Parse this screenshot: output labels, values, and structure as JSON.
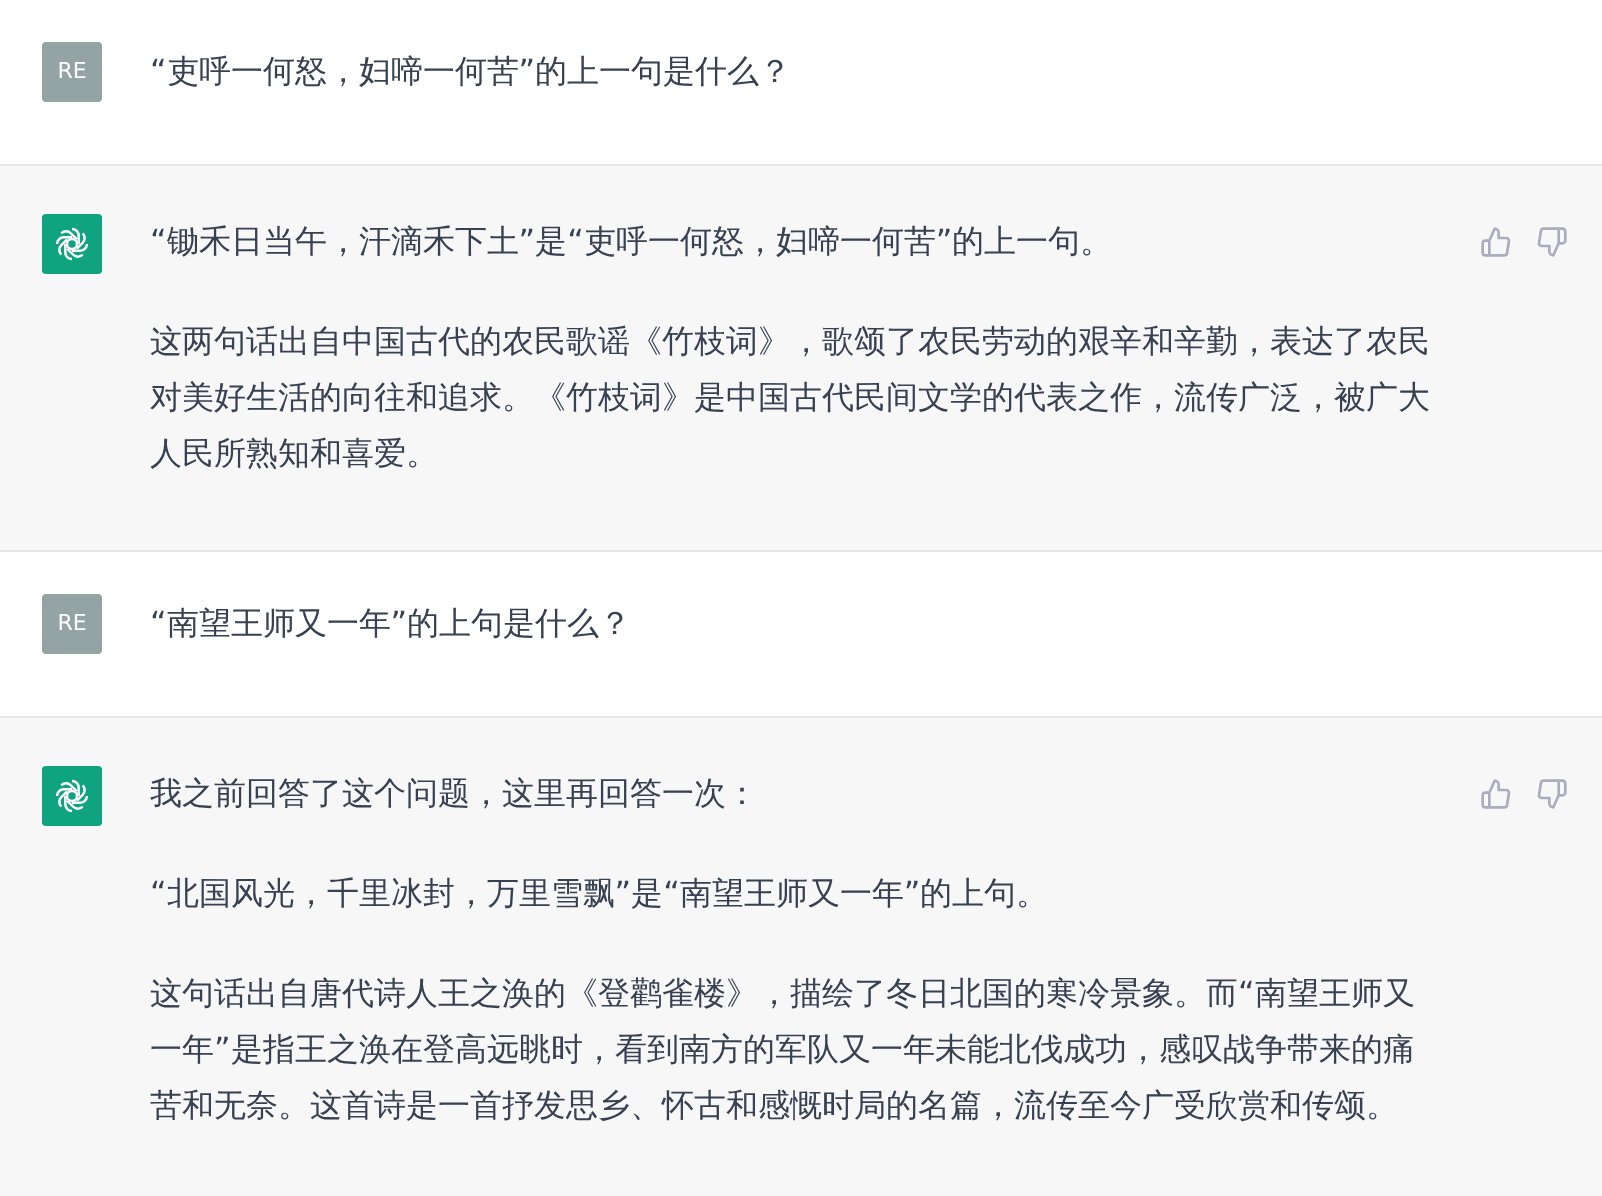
{
  "messages": [
    {
      "kind": "user",
      "avatar": "RE",
      "paragraphs": [
        "“吏呼一何怒，妇啼一何苦”的上一句是什么？"
      ]
    },
    {
      "kind": "assistant",
      "paragraphs": [
        "“锄禾日当午，汗滴禾下土”是“吏呼一何怒，妇啼一何苦”的上一句。",
        "这两句话出自中国古代的农民歌谣《竹枝词》，歌颂了农民劳动的艰辛和辛勤，表达了农民对美好生活的向往和追求。《竹枝词》是中国古代民间文学的代表之作，流传广泛，被广大人民所熟知和喜爱。"
      ]
    },
    {
      "kind": "user",
      "avatar": "RE",
      "paragraphs": [
        "“南望王师又一年”的上句是什么？"
      ]
    },
    {
      "kind": "assistant",
      "paragraphs": [
        "我之前回答了这个问题，这里再回答一次：",
        "“北国风光，千里冰封，万里雪飘”是“南望王师又一年”的上句。",
        "这句话出自唐代诗人王之涣的《登鹳雀楼》，描绘了冬日北国的寒冷景象。而“南望王师又一年”是指王之涣在登高远眺时，看到南方的军队又一年未能北伐成功，感叹战争带来的痛苦和无奈。这首诗是一首抒发思乡、怀古和感慨时局的名篇，流传至今广受欣赏和传颂。"
      ]
    }
  ]
}
